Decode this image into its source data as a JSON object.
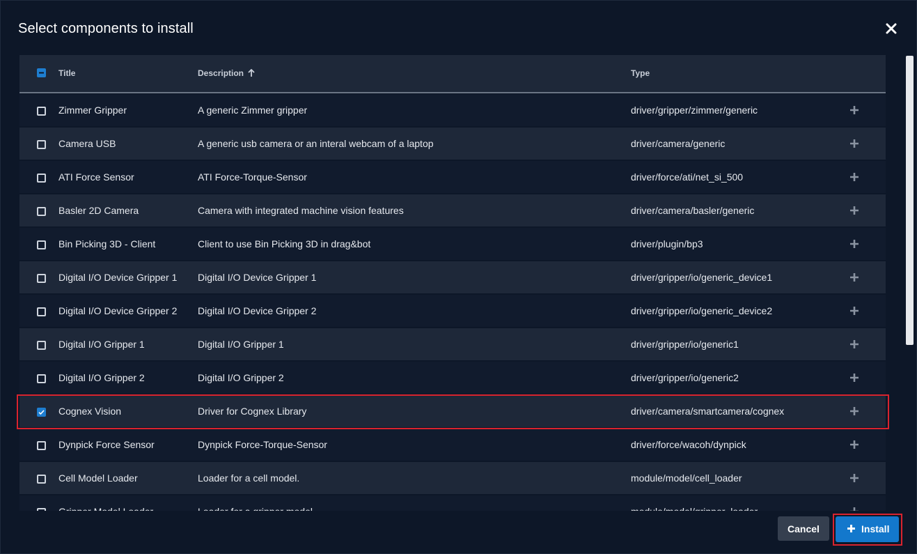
{
  "dialog": {
    "title": "Select components to install",
    "close_icon": "close-icon"
  },
  "table": {
    "headers": {
      "title": "Title",
      "description": "Description",
      "description_sort": "arrow-up-icon",
      "type": "Type"
    },
    "select_all_state": "indeterminate",
    "rows": [
      {
        "title": "Zimmer Gripper",
        "description": "A generic Zimmer gripper",
        "type": "driver/gripper/zimmer/generic",
        "checked": false
      },
      {
        "title": "Camera USB",
        "description": "A generic usb camera or an interal webcam of a laptop",
        "type": "driver/camera/generic",
        "checked": false
      },
      {
        "title": "ATI Force Sensor",
        "description": "ATI Force-Torque-Sensor",
        "type": "driver/force/ati/net_si_500",
        "checked": false
      },
      {
        "title": "Basler 2D Camera",
        "description": "Camera with integrated machine vision features",
        "type": "driver/camera/basler/generic",
        "checked": false
      },
      {
        "title": "Bin Picking 3D - Client",
        "description": "Client to use Bin Picking 3D in drag&bot",
        "type": "driver/plugin/bp3",
        "checked": false
      },
      {
        "title": "Digital I/O Device Gripper 1",
        "description": "Digital I/O Device Gripper 1",
        "type": "driver/gripper/io/generic_device1",
        "checked": false
      },
      {
        "title": "Digital I/O Device Gripper 2",
        "description": "Digital I/O Device Gripper 2",
        "type": "driver/gripper/io/generic_device2",
        "checked": false
      },
      {
        "title": "Digital I/O Gripper 1",
        "description": "Digital I/O Gripper 1",
        "type": "driver/gripper/io/generic1",
        "checked": false
      },
      {
        "title": "Digital I/O Gripper 2",
        "description": "Digital I/O Gripper 2",
        "type": "driver/gripper/io/generic2",
        "checked": false
      },
      {
        "title": "Cognex Vision",
        "description": "Driver for Cognex Library",
        "type": "driver/camera/smartcamera/cognex",
        "checked": true
      },
      {
        "title": "Dynpick Force Sensor",
        "description": "Dynpick Force-Torque-Sensor",
        "type": "driver/force/wacoh/dynpick",
        "checked": false
      },
      {
        "title": "Cell Model Loader",
        "description": "Loader for a cell model.",
        "type": "module/model/cell_loader",
        "checked": false
      },
      {
        "title": "Gripper Model Loader",
        "description": "Loader for a gripper model.",
        "type": "module/model/gripper_loader",
        "checked": false
      }
    ],
    "row_action_icon": "plus-icon"
  },
  "footer": {
    "cancel_label": "Cancel",
    "install_label": "Install",
    "install_icon": "plus-icon"
  },
  "colors": {
    "background": "#0d1728",
    "row_odd": "#111b2d",
    "row_even": "#1e2839",
    "accent": "#1378cc",
    "highlight": "#d9232e"
  }
}
